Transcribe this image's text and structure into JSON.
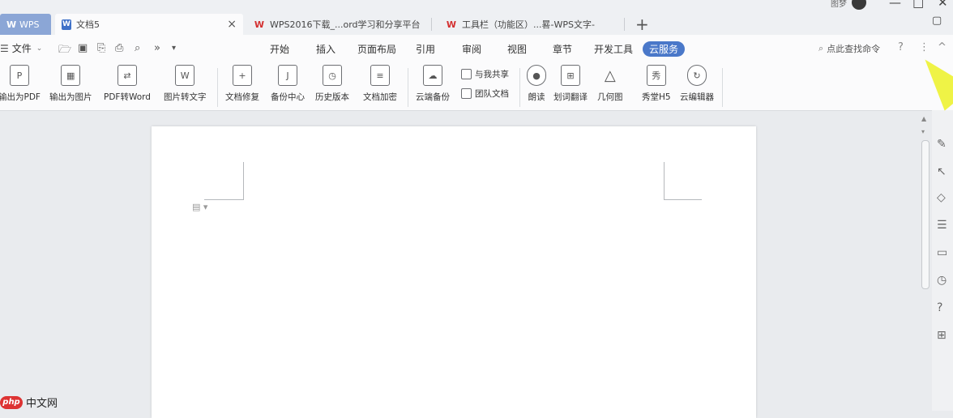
{
  "titlebar": {
    "tabs": [
      {
        "label": "WPS"
      },
      {
        "label": "文档5"
      },
      {
        "label": "WPS2016下载_...ord学习和分享平台"
      },
      {
        "label": "工具栏（功能区）...晷-WPS文字-"
      }
    ],
    "user_name": "图梦",
    "new_tab_glyph": "+",
    "close_glyph": "×",
    "win_buttons": [
      "—",
      "□",
      "✕"
    ]
  },
  "menubar": {
    "file_label": "文件",
    "quick_access_icons": [
      "open-folder-icon",
      "save-icon",
      "export-icon",
      "print-icon",
      "preview-icon"
    ],
    "tabs": [
      "开始",
      "插入",
      "页面布局",
      "引用",
      "审阅",
      "视图",
      "章节",
      "开发工具",
      "云服务"
    ],
    "active_tab": "云服务",
    "search_placeholder": "点此查找命令",
    "help_glyph": "?",
    "more_glyph": "⋮",
    "collapse_glyph": "^"
  },
  "toolbar": {
    "tools": [
      {
        "label": "输出为PDF",
        "icon": "export-pdf-icon"
      },
      {
        "label": "输出为图片",
        "icon": "export-image-icon"
      },
      {
        "label": "PDF转Word",
        "icon": "pdf-to-word-icon"
      },
      {
        "label": "图片转文字",
        "icon": "image-to-text-icon"
      },
      {
        "label": "文档修复",
        "icon": "doc-repair-icon"
      },
      {
        "label": "备份中心",
        "icon": "backup-center-icon"
      },
      {
        "label": "历史版本",
        "icon": "history-version-icon"
      },
      {
        "label": "文档加密",
        "icon": "doc-encrypt-icon"
      },
      {
        "label": "云端备份",
        "icon": "cloud-backup-icon"
      },
      {
        "label": "朗读",
        "icon": "microphone-icon"
      },
      {
        "label": "划词翻译",
        "icon": "translate-icon"
      },
      {
        "label": "几何图",
        "icon": "geometry-icon"
      },
      {
        "label": "秀堂H5",
        "icon": "h5-icon"
      },
      {
        "label": "云编辑器",
        "icon": "cloud-editor-icon"
      }
    ],
    "small_tools": [
      {
        "label": "与我共享",
        "icon": "share-icon"
      },
      {
        "label": "团队文档",
        "icon": "team-doc-icon"
      }
    ]
  },
  "watermark": {
    "logo": "php",
    "text": "中文网"
  },
  "colors": {
    "accent": "#4a78c9",
    "annotation_arrow": "#eef23c",
    "wps_red": "#d32f2f"
  }
}
